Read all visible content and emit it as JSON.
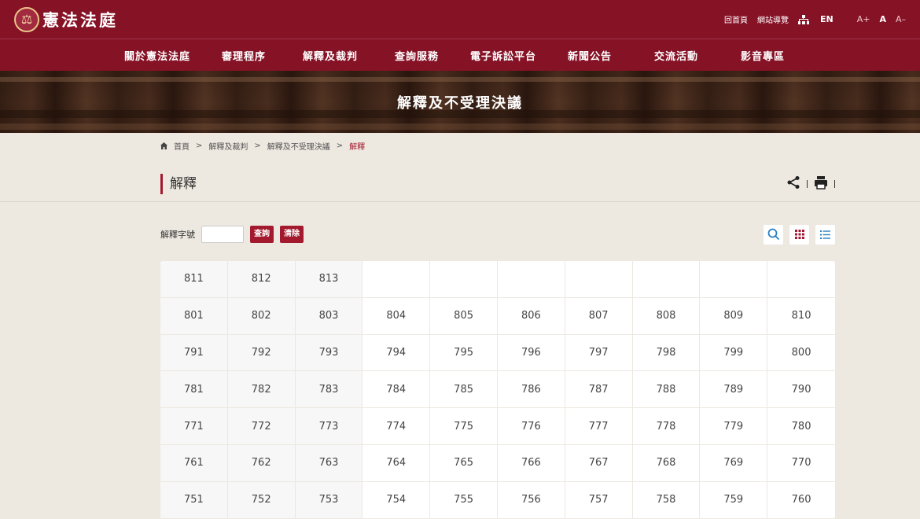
{
  "header": {
    "site_name": "憲法法庭",
    "logo_icon": "court-emblem",
    "util_links": [
      "回首頁",
      "網站導覽"
    ],
    "lang": "EN",
    "font_sizes": [
      "A+",
      "A",
      "A–"
    ]
  },
  "nav": {
    "items": [
      "關於憲法法庭",
      "審理程序",
      "解釋及裁判",
      "查詢服務",
      "電子訴訟平台",
      "新聞公告",
      "交流活動",
      "影音專區"
    ]
  },
  "banner": {
    "title": "解釋及不受理決議"
  },
  "breadcrumb": {
    "items": [
      "首頁",
      "解釋及裁判",
      "解釋及不受理決議"
    ],
    "current": "解釋"
  },
  "page": {
    "title": "解釋"
  },
  "search": {
    "label": "解釋字號",
    "input_value": "",
    "query_button": "查詢",
    "clear_button": "清除"
  },
  "grid": {
    "rows": [
      [
        "811",
        "812",
        "813",
        "",
        "",
        "",
        "",
        "",
        "",
        ""
      ],
      [
        "801",
        "802",
        "803",
        "804",
        "805",
        "806",
        "807",
        "808",
        "809",
        "810"
      ],
      [
        "791",
        "792",
        "793",
        "794",
        "795",
        "796",
        "797",
        "798",
        "799",
        "800"
      ],
      [
        "781",
        "782",
        "783",
        "784",
        "785",
        "786",
        "787",
        "788",
        "789",
        "790"
      ],
      [
        "771",
        "772",
        "773",
        "774",
        "775",
        "776",
        "777",
        "778",
        "779",
        "780"
      ],
      [
        "761",
        "762",
        "763",
        "764",
        "765",
        "766",
        "767",
        "768",
        "769",
        "770"
      ],
      [
        "751",
        "752",
        "753",
        "754",
        "755",
        "756",
        "757",
        "758",
        "759",
        "760"
      ]
    ]
  },
  "colors": {
    "brand": "#861226",
    "accent": "#a3192d",
    "background": "#ede8e0"
  }
}
